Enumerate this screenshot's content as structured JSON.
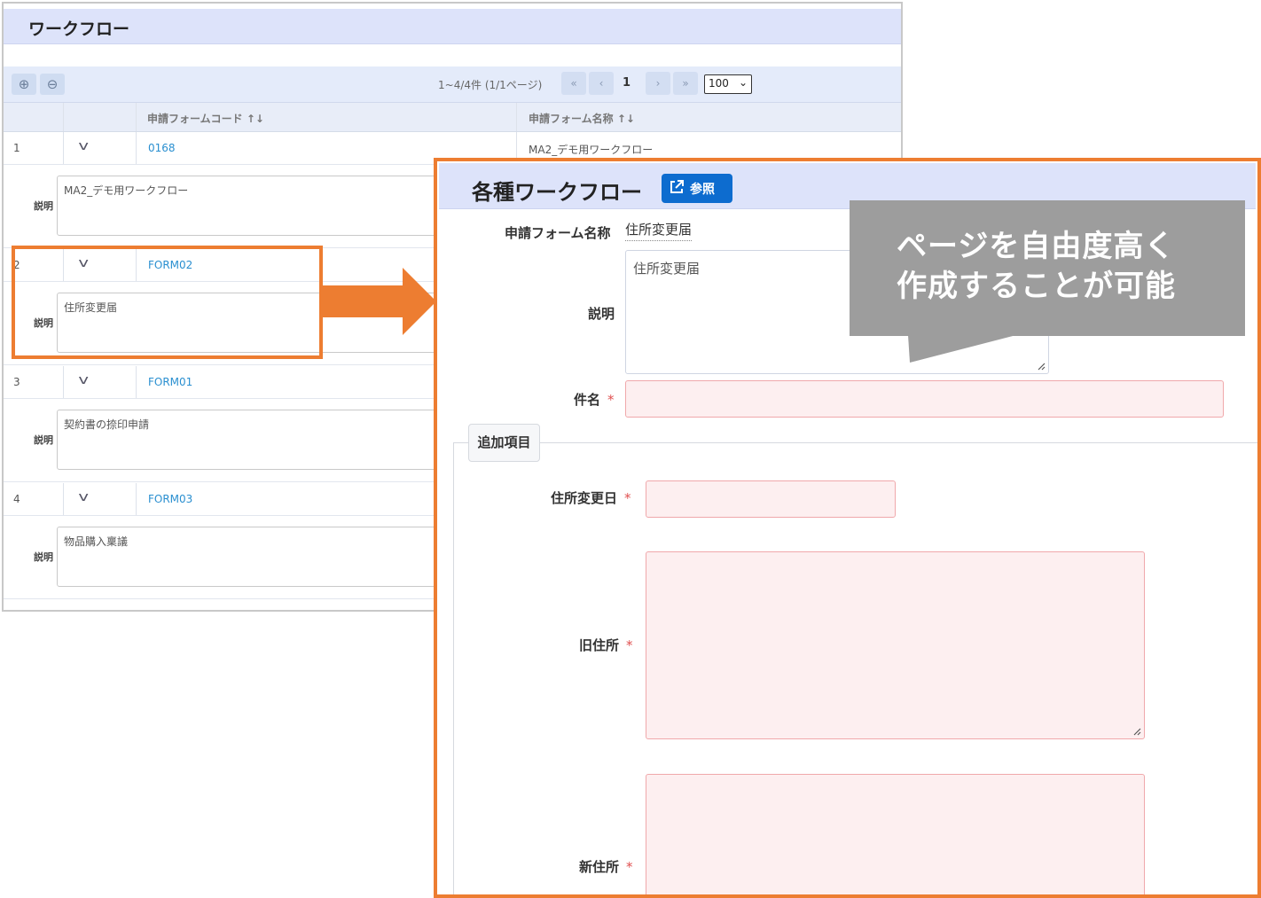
{
  "list_panel": {
    "title": "ワークフロー",
    "toolbar": {
      "add_icon": "⊕",
      "remove_icon": "⊖",
      "pagination_info": "1~4/4件 (1/1ページ)",
      "first_icon": "«",
      "prev_icon": "‹",
      "current_page": "1",
      "next_icon": "›",
      "last_icon": "»",
      "page_size": "100"
    },
    "columns": [
      "申請フォームコード ↑↓",
      "申請フォーム名称 ↑↓"
    ],
    "description_label": "説明",
    "rows": [
      {
        "num": "1",
        "code": "0168",
        "name": "MA2_デモ用ワークフロー",
        "description": "MA2_デモ用ワークフロー"
      },
      {
        "num": "2",
        "code": "FORM02",
        "name": "",
        "description": "住所変更届"
      },
      {
        "num": "3",
        "code": "FORM01",
        "name": "",
        "description": "契約書の捺印申請"
      },
      {
        "num": "4",
        "code": "FORM03",
        "name": "",
        "description": "物品購入稟議"
      }
    ]
  },
  "form_panel": {
    "title": "各種ワークフロー",
    "ref_button": "参照",
    "form_name_label": "申請フォーム名称",
    "form_name_value": "住所変更届",
    "description_label": "説明",
    "description_value": "住所変更届",
    "subject_label": "件名",
    "required_mark": "*",
    "section_title": "追加項目",
    "fields": {
      "change_date": "住所変更日",
      "old_address": "旧住所",
      "new_address": "新住所"
    }
  },
  "callout": {
    "line1": "ページを自由度高く",
    "line2": "作成することが可能"
  },
  "colors": {
    "accent_orange": "#ed7d31",
    "header_bg": "#dde3fa",
    "link_blue": "#2a8fd0",
    "button_blue": "#0d6ccf",
    "error_bg": "#fdeff0",
    "error_border": "#f0a8ab",
    "callout_gray": "#9d9d9d"
  }
}
